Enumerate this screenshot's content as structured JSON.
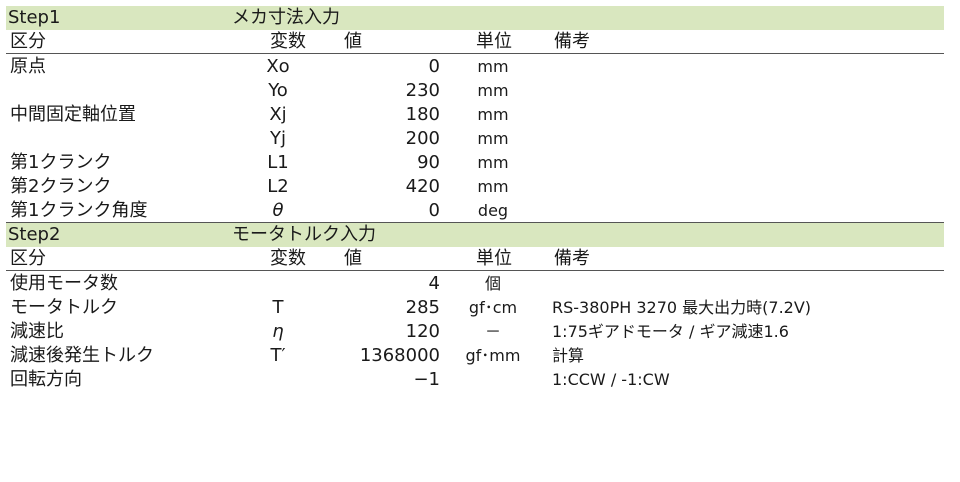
{
  "step1": {
    "title": "Step1",
    "name": "メカ寸法入力",
    "headers": {
      "category": "区分",
      "variable": "変数",
      "value": "値",
      "unit": "単位",
      "note": "備考"
    },
    "rows": [
      {
        "category": "原点",
        "variable": "Xo",
        "value": "0",
        "unit": "mm",
        "note": ""
      },
      {
        "category": "",
        "variable": "Yo",
        "value": "230",
        "unit": "mm",
        "note": ""
      },
      {
        "category": "中間固定軸位置",
        "variable": "Xj",
        "value": "180",
        "unit": "mm",
        "note": ""
      },
      {
        "category": "",
        "variable": "Yj",
        "value": "200",
        "unit": "mm",
        "note": ""
      },
      {
        "category": "第1クランク",
        "variable": "L1",
        "value": "90",
        "unit": "mm",
        "note": ""
      },
      {
        "category": "第2クランク",
        "variable": "L2",
        "value": "420",
        "unit": "mm",
        "note": ""
      },
      {
        "category": "第1クランク角度",
        "variable": "θ",
        "value": "0",
        "unit": "deg",
        "note": ""
      }
    ]
  },
  "step2": {
    "title": "Step2",
    "name": "モータトルク入力",
    "headers": {
      "category": "区分",
      "variable": "変数",
      "value": "値",
      "unit": "単位",
      "note": "備考"
    },
    "rows": [
      {
        "category": "使用モータ数",
        "variable": "",
        "value": "4",
        "unit": "個",
        "note": ""
      },
      {
        "category": "モータトルク",
        "variable": "T",
        "value": "285",
        "unit": "gf･cm",
        "note": "RS-380PH 3270 最大出力時(7.2V)"
      },
      {
        "category": "減速比",
        "variable": "η",
        "value": "120",
        "unit": "－",
        "note": "1:75ギアドモータ / ギア減速1.6"
      },
      {
        "category": "減速後発生トルク",
        "variable": "T′",
        "value": "1368000",
        "unit": "gf･mm",
        "note": "計算"
      },
      {
        "category": "回転方向",
        "variable": "",
        "value": "−1",
        "unit": "",
        "note": "1:CCW / -1:CW"
      }
    ]
  },
  "colors": {
    "step_band": "#d9e7bf",
    "text": "#1a1a1a",
    "rule": "#555555"
  }
}
